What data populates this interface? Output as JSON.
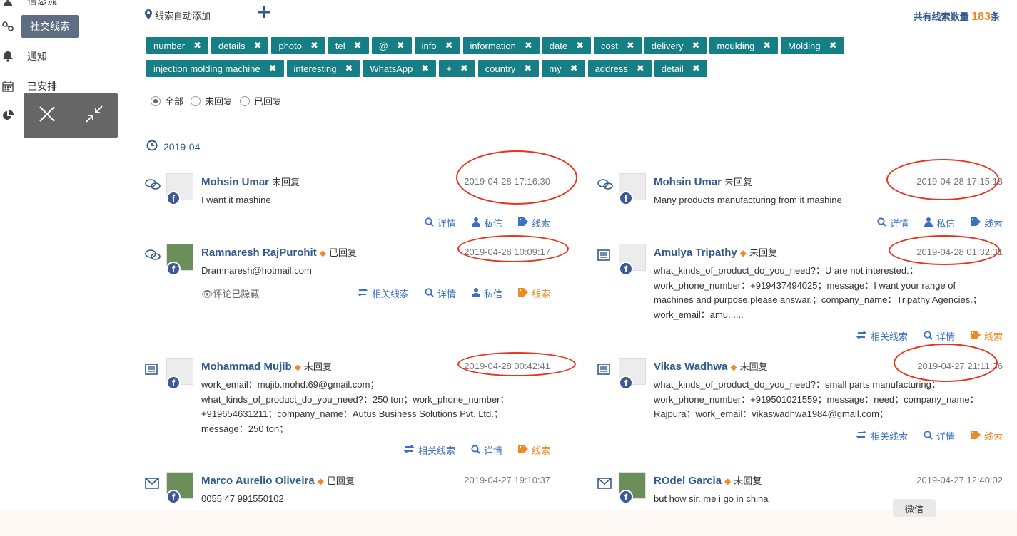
{
  "sidebar": {
    "items": [
      {
        "label": "信息流",
        "icon": "user-icon"
      },
      {
        "label": "社交线索",
        "icon": "link-icon"
      },
      {
        "label": "通知",
        "icon": "bell-icon"
      },
      {
        "label": "已安排",
        "icon": "calendar-icon"
      },
      {
        "label": "",
        "icon": "pie-chart-icon"
      }
    ]
  },
  "header": {
    "auto_add_label": "线索自动添加",
    "total_prefix": "共有线索数量",
    "total_count": "183",
    "total_suffix": "条"
  },
  "tags": [
    "number",
    "details",
    "photo",
    "tel",
    "@",
    "info",
    "information",
    "date",
    "cost",
    "delivery",
    "moulding",
    "Molding",
    "injection molding machine",
    "interesting",
    "WhatsApp",
    "+",
    "country",
    "my",
    "address",
    "detail"
  ],
  "filters": {
    "all": "全部",
    "unreplied": "未回复",
    "replied": "已回复",
    "selected": "all"
  },
  "month": "2019-04",
  "actions": {
    "detail": "详情",
    "private": "私信",
    "lead": "线索",
    "related": "相关线索",
    "hidden_comment": "评论已隐藏"
  },
  "leads": [
    {
      "name": "Mohsin Umar",
      "status": "未回复",
      "time": "2019-04-28 17:16:30",
      "message": "I want it mashine",
      "icon": "chat-icon"
    },
    {
      "name": "Mohsin Umar",
      "status": "未回复",
      "time": "2019-04-28 17:15:18",
      "message": "Many products manufacturing from it mashine",
      "icon": "chat-icon"
    },
    {
      "name": "Ramnaresh RajPurohit",
      "status": "已回复",
      "time": "2019-04-28 10:09:17",
      "message": "Dramnaresh@hotmail.com",
      "icon": "chat-icon"
    },
    {
      "name": "Amulya Tripathy",
      "status": "未回复",
      "time": "2019-04-28 01:32:31",
      "message": "what_kinds_of_product_do_you_need?：U are not interested.；work_phone_number：+919437494025；message：I want your range of machines and purpose,please answar.；company_name：Tripathy Agencies.；work_email：amu......",
      "icon": "form-icon"
    },
    {
      "name": "Mohammad Mujib",
      "status": "未回复",
      "time": "2019-04-28 00:42:41",
      "message": "work_email：mujib.mohd.69@gmail.com；what_kinds_of_product_do_you_need?：250 ton；work_phone_number：+919654631211；company_name：Autus Business Solutions Pvt. Ltd.；message：250 ton；",
      "icon": "form-icon"
    },
    {
      "name": "Vikas Wadhwa",
      "status": "未回复",
      "time": "2019-04-27 21:11:36",
      "message": "what_kinds_of_product_do_you_need?：small parts manufacturing；work_phone_number：+919501021559；message：need；company_name：Rajpura；work_email：vikaswadhwa1984@gmail.com；",
      "icon": "form-icon"
    },
    {
      "name": "Marco Aurelio Oliveira",
      "status": "已回复",
      "time": "2019-04-27 19:10:37",
      "message": "0055 47 991550102",
      "icon": "mail-icon"
    },
    {
      "name": "ROdel Garcia",
      "status": "未回复",
      "time": "2019-04-27 12:40:02",
      "message": "but how sir..me i go in china",
      "icon": "mail-icon"
    }
  ],
  "wechat_label": "微信"
}
